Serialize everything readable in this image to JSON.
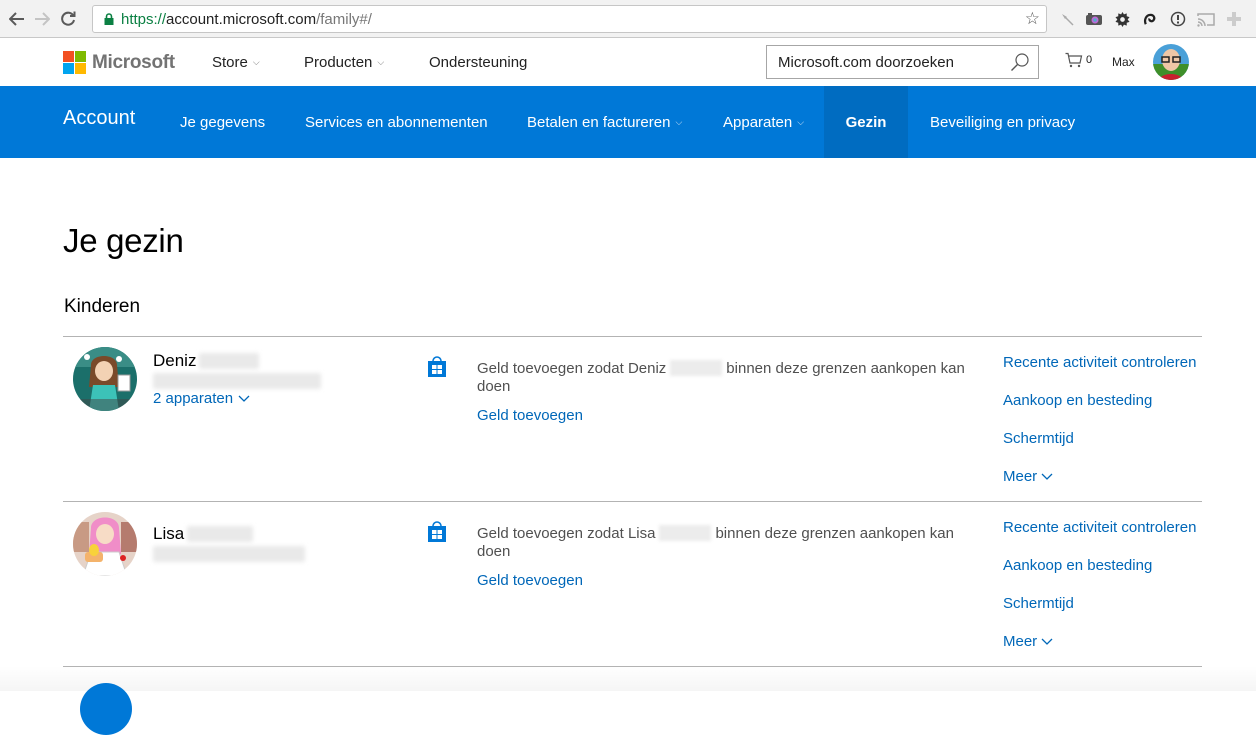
{
  "browser": {
    "url_scheme": "https://",
    "url_host": "account.microsoft.com",
    "url_path": "/family#/",
    "extensions": [
      "pin-icon",
      "camera-icon",
      "gear-icon",
      "swirl-icon",
      "info-icon",
      "cast-icon",
      "plus-icon"
    ]
  },
  "header": {
    "logo_text": "Microsoft",
    "nav": [
      {
        "label": "Store",
        "has_dropdown": true
      },
      {
        "label": "Producten",
        "has_dropdown": true
      },
      {
        "label": "Ondersteuning",
        "has_dropdown": false
      }
    ],
    "search_placeholder": "Microsoft.com doorzoeken",
    "cart_count": "0",
    "user_name": "Max"
  },
  "account_nav": {
    "brand": "Account",
    "items": [
      {
        "label": "Je gegevens",
        "has_dropdown": false,
        "active": false
      },
      {
        "label": "Services en abonnementen",
        "has_dropdown": false,
        "active": false
      },
      {
        "label": "Betalen en factureren",
        "has_dropdown": true,
        "active": false
      },
      {
        "label": "Apparaten",
        "has_dropdown": true,
        "active": false
      },
      {
        "label": "Gezin",
        "has_dropdown": false,
        "active": true
      },
      {
        "label": "Beveiliging en privacy",
        "has_dropdown": false,
        "active": false
      }
    ]
  },
  "main": {
    "title": "Je gezin",
    "section_title": "Kinderen",
    "children": [
      {
        "first_name": "Deniz",
        "devices_label": "2 apparaten",
        "desc_before": "Geld toevoegen zodat Deniz",
        "desc_after": "binnen deze grenzen aankopen kan doen",
        "add_money": "Geld toevoegen",
        "links": [
          "Recente activiteit controleren",
          "Aankoop en besteding",
          "Schermtijd",
          "Meer"
        ]
      },
      {
        "first_name": "Lisa",
        "devices_label": "",
        "desc_before": "Geld toevoegen zodat Lisa",
        "desc_after": "binnen deze grenzen aankopen kan doen",
        "add_money": "Geld toevoegen",
        "links": [
          "Recente activiteit controleren",
          "Aankoop en besteding",
          "Schermtijd",
          "Meer"
        ]
      }
    ]
  },
  "colors": {
    "accent": "#0078d7",
    "active_tab": "#006cc1",
    "link": "#0067b8",
    "ms_red": "#f25022",
    "ms_green": "#7fba00",
    "ms_blue": "#00a4ef",
    "ms_yellow": "#ffb900"
  }
}
